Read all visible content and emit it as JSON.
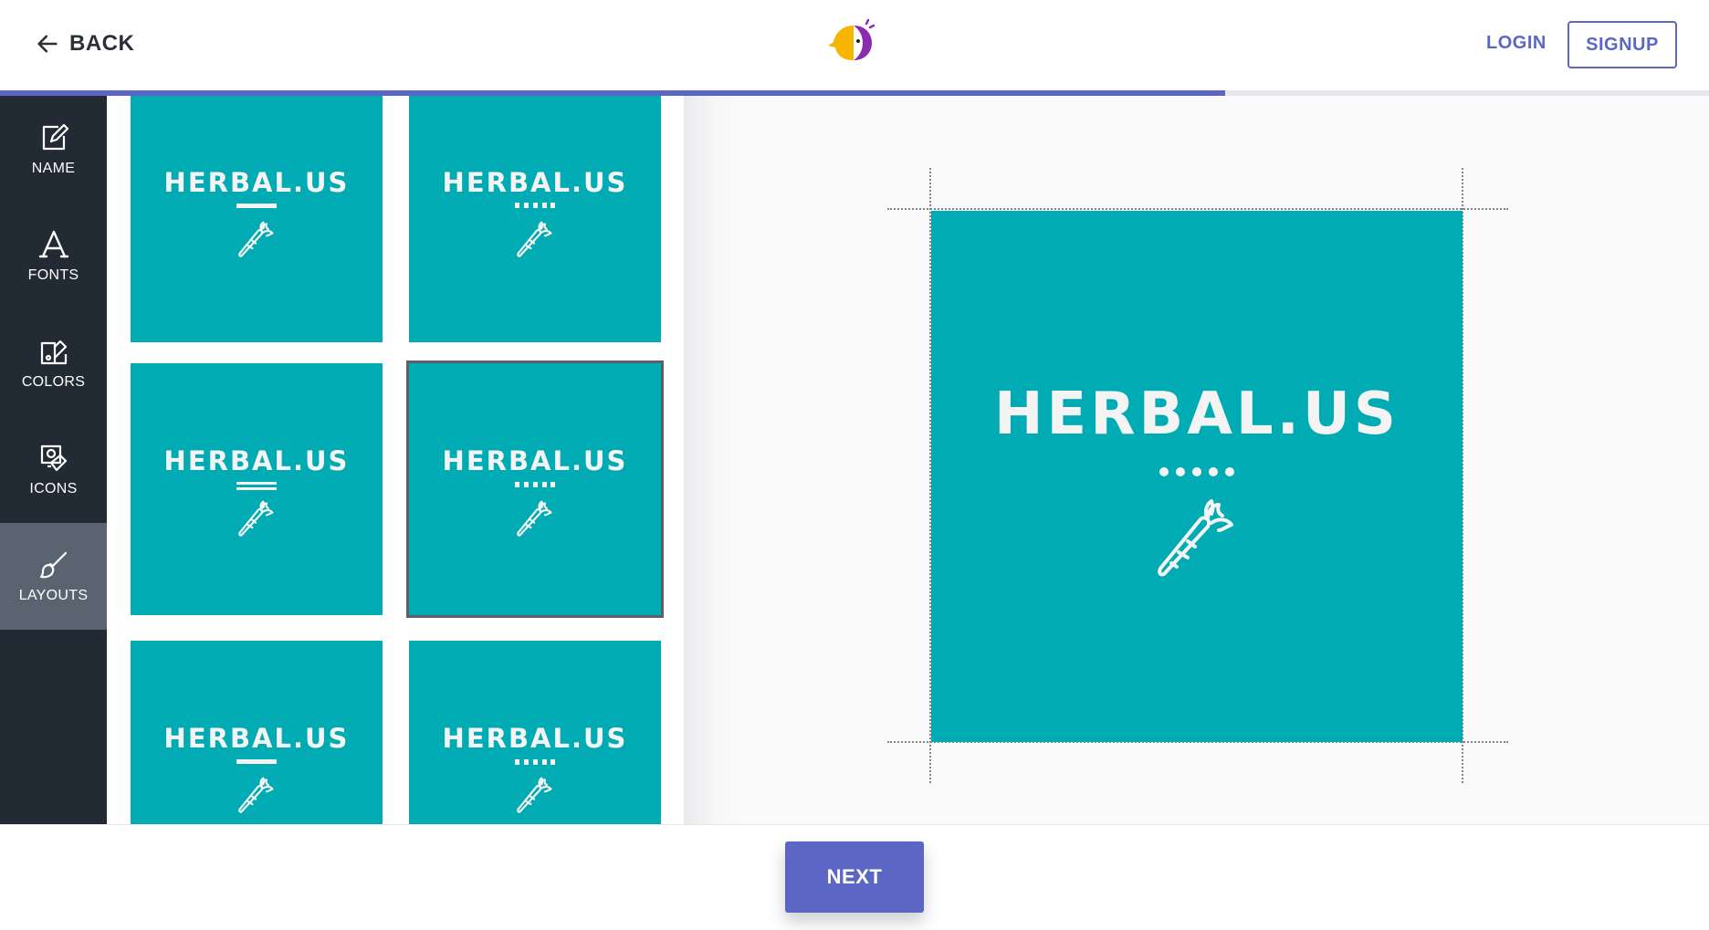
{
  "header": {
    "back_label": "BACK",
    "login_label": "LOGIN",
    "signup_label": "SIGNUP",
    "logo_icon": "parrot-logo-icon"
  },
  "progress": {
    "fraction": 0.717,
    "color": "#5c67c5"
  },
  "sidebar": {
    "items": [
      {
        "label": "NAME",
        "icon": "edit-icon"
      },
      {
        "label": "FONTS",
        "icon": "font-icon"
      },
      {
        "label": "COLORS",
        "icon": "palette-icon"
      },
      {
        "label": "ICONS",
        "icon": "shapes-icon"
      },
      {
        "label": "LAYOUTS",
        "icon": "brush-icon",
        "active": true
      }
    ]
  },
  "layouts": {
    "tiles": [
      {
        "text": "HERBAL.US",
        "decoration": "line",
        "icon": "carrot-icon"
      },
      {
        "text": "HERBAL.US",
        "decoration": "dots",
        "icon": "carrot-icon"
      },
      {
        "text": "HERBAL.US",
        "decoration": "double-line",
        "icon": "carrot-icon"
      },
      {
        "text": "HERBAL.US",
        "decoration": "dots",
        "icon": "carrot-icon",
        "selected": true
      },
      {
        "text": "HERBAL.US",
        "decoration": "line",
        "icon": "carrot-icon"
      },
      {
        "text": "HERBAL.US",
        "decoration": "dots",
        "icon": "carrot-icon"
      }
    ]
  },
  "preview": {
    "brand_text": "HERBAL.US",
    "decoration": "dots",
    "icon": "carrot-icon",
    "background_color": "#00abb3",
    "text_color": "#f4f4f4"
  },
  "footer": {
    "next_label": "NEXT"
  }
}
